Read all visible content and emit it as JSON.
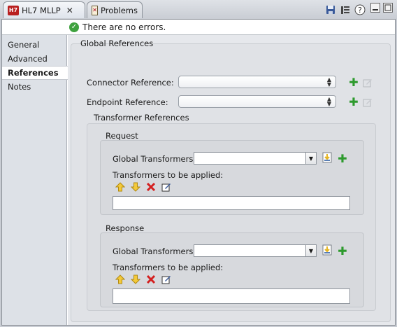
{
  "tabs": [
    {
      "label": "HL7 MLLP",
      "icon": "hl7-icon",
      "active": true
    },
    {
      "label": "Problems",
      "icon": "problems-icon",
      "active": false
    }
  ],
  "status": {
    "message": "There are no errors.",
    "icon": "check-circle-icon"
  },
  "sidebar": {
    "items": [
      {
        "label": "General"
      },
      {
        "label": "Advanced"
      },
      {
        "label": "References",
        "selected": true
      },
      {
        "label": "Notes"
      }
    ]
  },
  "global_references": {
    "title": "Global References",
    "connector_label": "Connector Reference:",
    "endpoint_label": "Endpoint Reference:"
  },
  "transformer_references": {
    "title": "Transformer References",
    "request": {
      "title": "Request",
      "global_label": "Global Transformers:",
      "applied_label": "Transformers to be applied:"
    },
    "response": {
      "title": "Response",
      "global_label": "Global Transformers:",
      "applied_label": "Transformers to be applied:"
    }
  },
  "colors": {
    "add": "#2d9a2d",
    "remove": "#d42020",
    "arrow": "#e5b420",
    "ok": "#3fa23f"
  }
}
